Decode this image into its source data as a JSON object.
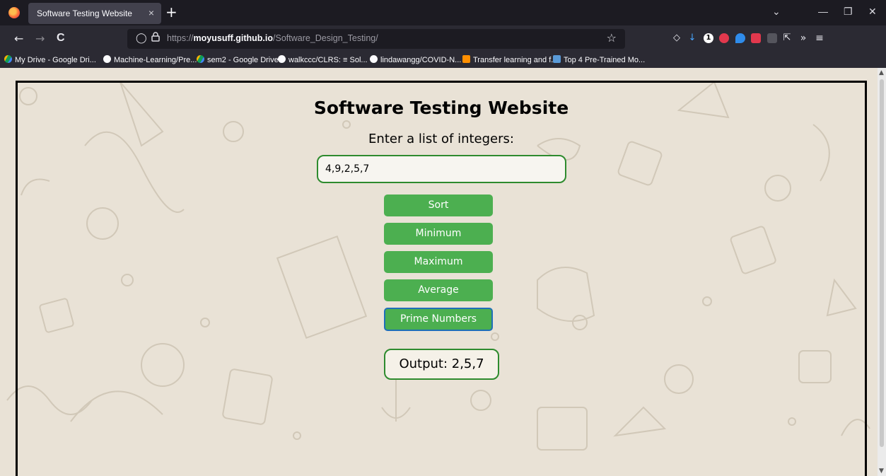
{
  "browser": {
    "tab_title": "Software Testing Website",
    "tab_close": "×",
    "new_tab": "+",
    "url_prefix": "https://",
    "url_host": "moyusuff.github.io",
    "url_path": "/Software_Design_Testing/",
    "window_controls": {
      "list": "⌄",
      "minimize": "—",
      "restore": "❐",
      "close": "✕"
    },
    "nav": {
      "back": "←",
      "forward": "→",
      "reload": "C"
    },
    "bookmarks": [
      {
        "label": "My Drive - Google Dri...",
        "icon": "google-drive-icon"
      },
      {
        "label": "Machine-Learning/Pre...",
        "icon": "github-icon"
      },
      {
        "label": "sem2 - Google Drive",
        "icon": "google-drive-icon"
      },
      {
        "label": "walkccc/CLRS: ≡ Sol...",
        "icon": "github-icon"
      },
      {
        "label": "lindawangg/COVID-N...",
        "icon": "github-icon"
      },
      {
        "label": "Transfer learning and f...",
        "icon": "tensorflow-icon"
      },
      {
        "label": "Top 4 Pre-Trained Mo...",
        "icon": "bookmark-icon"
      }
    ]
  },
  "page": {
    "title": "Software Testing Website",
    "prompt": "Enter a list of integers:",
    "input_value": "4,9,2,5,7",
    "buttons": {
      "sort": "Sort",
      "minimum": "Minimum",
      "maximum": "Maximum",
      "average": "Average",
      "prime": "Prime Numbers"
    },
    "output": "Output: 2,5,7"
  },
  "colors": {
    "button_green": "#4caf50",
    "border_green": "#2e8b2e",
    "page_bg": "#e9e2d6",
    "focus_blue": "#1e6fb8"
  }
}
